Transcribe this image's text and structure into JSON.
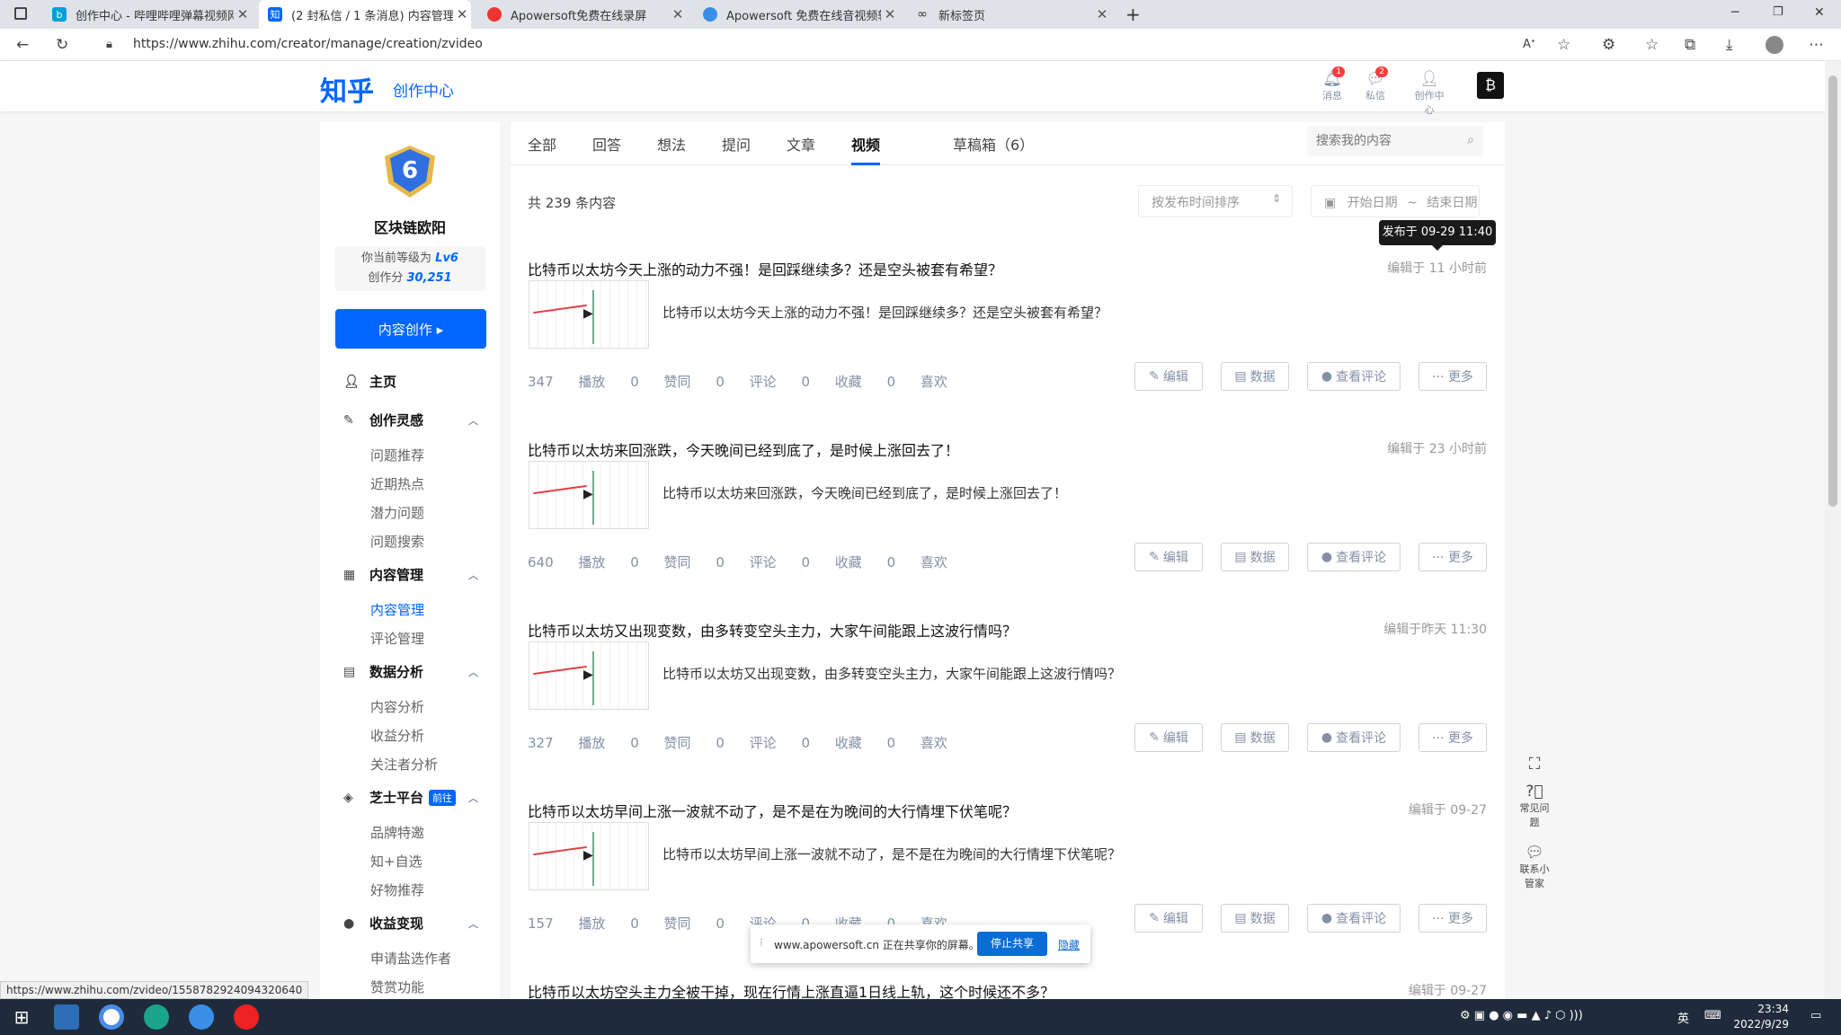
{
  "browser": {
    "tabs": [
      {
        "title": "创作中心 - 哔哩哔哩弹幕视频网",
        "fav": "bilibili-icon",
        "color": "#00a1d6"
      },
      {
        "title": "(2 封私信 / 1 条消息) 内容管理",
        "fav": "zhihu-icon",
        "color": "#0066ff",
        "active": true
      },
      {
        "title": "Apowersoft免费在线录屏",
        "fav": "record-icon",
        "color": "#e33"
      },
      {
        "title": "Apowersoft 免费在线音视频转",
        "fav": "apowersoft-icon",
        "color": "#3a8ee6"
      },
      {
        "title": "新标签页",
        "fav": "new-tab-icon",
        "color": "#555"
      }
    ],
    "url": "https://www.zhihu.com/creator/manage/creation/zvideo",
    "status_url": "https://www.zhihu.com/zvideo/1558782924094320640"
  },
  "header": {
    "logo": "知乎",
    "sublogo": "创作中心",
    "messages": {
      "label": "消息",
      "count": "1"
    },
    "letters": {
      "label": "私信",
      "count": "2"
    },
    "creator": {
      "label": "创作中心"
    }
  },
  "sidebar": {
    "level_number": "6",
    "username": "区块链欧阳",
    "level_text": "你当前等级为 ",
    "level": "Lv6",
    "score_text": "创作分 ",
    "score": "30,251",
    "create_button": "内容创作 ▸",
    "home": "主页",
    "sections": [
      {
        "title": "创作灵感",
        "items": [
          "问题推荐",
          "近期热点",
          "潜力问题",
          "问题搜索"
        ]
      },
      {
        "title": "内容管理",
        "items": [
          "内容管理",
          "评论管理"
        ]
      },
      {
        "title": "数据分析",
        "items": [
          "内容分析",
          "收益分析",
          "关注者分析"
        ]
      },
      {
        "title": "芝士平台",
        "tag": "前往",
        "items": [
          "品牌特邀",
          "知+自选",
          "好物推荐"
        ]
      },
      {
        "title": "收益变现",
        "items": [
          "申请盐选作者",
          "赞赏功能"
        ]
      }
    ]
  },
  "main": {
    "tabs": [
      "全部",
      "回答",
      "想法",
      "提问",
      "文章",
      "视频"
    ],
    "drafts": "草稿箱（6）",
    "search_placeholder": "搜索我的内容",
    "total": "共 239 条内容",
    "sort": "按发布时间排序",
    "date_start": "开始日期",
    "date_sep": "~",
    "date_end": "结束日期",
    "tooltip": "发布于 09-29 11:40",
    "actions": {
      "edit": "编辑",
      "data": "数据",
      "comments": "查看评论",
      "more": "··· 更多"
    },
    "items": [
      {
        "title": "比特币以太坊今天上涨的动力不强！是回踩继续多？还是空头被套有希望？",
        "time": "编辑于 11 小时前",
        "desc": "比特币以太坊今天上涨的动力不强！是回踩继续多？还是空头被套有希望？",
        "plays": "347",
        "likes": "0",
        "comments": "0",
        "favs": "0",
        "loves": "0"
      },
      {
        "title": "比特币以太坊来回涨跌，今天晚间已经到底了，是时候上涨回去了！",
        "time": "编辑于 23 小时前",
        "desc": "比特币以太坊来回涨跌，今天晚间已经到底了，是时候上涨回去了！",
        "plays": "640",
        "likes": "0",
        "comments": "0",
        "favs": "0",
        "loves": "0"
      },
      {
        "title": "比特币以太坊又出现变数，由多转变空头主力，大家午间能跟上这波行情吗？",
        "time": "编辑于昨天 11:30",
        "desc": "比特币以太坊又出现变数，由多转变空头主力，大家午间能跟上这波行情吗？",
        "plays": "327",
        "likes": "0",
        "comments": "0",
        "favs": "0",
        "loves": "0"
      },
      {
        "title": "比特币以太坊早间上涨一波就不动了，是不是在为晚间的大行情埋下伏笔呢？",
        "time": "编辑于 09-27",
        "desc": "比特币以太坊早间上涨一波就不动了，是不是在为晚间的大行情埋下伏笔呢？",
        "plays": "157",
        "likes": "0",
        "comments": "0",
        "favs": "0",
        "loves": "0"
      },
      {
        "title": "比特币以太坊空头主力全被干掉，现在行情上涨直逼1日线上轨，这个时候还不多？",
        "time": "编辑于 09-27"
      }
    ],
    "stat_labels": {
      "plays": "播放",
      "likes": "赞同",
      "comments": "评论",
      "favs": "收藏",
      "loves": "喜欢"
    }
  },
  "float": {
    "faq": "常见问题",
    "contact": "联系小管家"
  },
  "share": {
    "text": "www.apowersoft.cn 正在共享你的屏幕。",
    "stop": "停止共享",
    "hide": "隐藏"
  },
  "taskbar": {
    "time": "23:34",
    "date": "2022/9/29",
    "ime": "英"
  }
}
